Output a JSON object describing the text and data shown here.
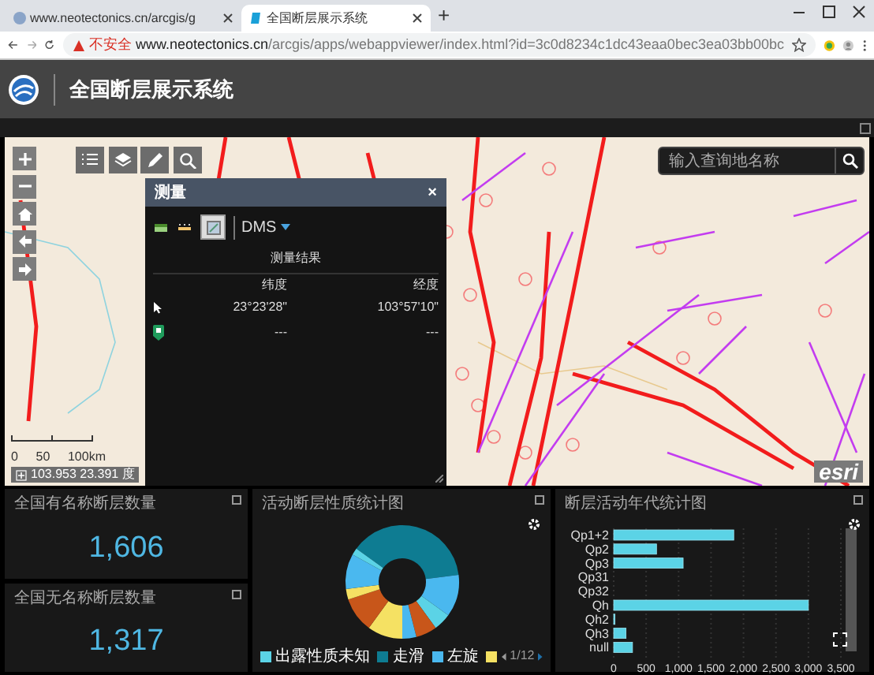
{
  "browser": {
    "tabs": [
      {
        "title": "www.neotectonics.cn/arcgis/g",
        "selected": false
      },
      {
        "title": "全国断层展示系统",
        "selected": true
      }
    ],
    "new_tab": "+",
    "security": "不安全",
    "url_host": "www.neotectonics.cn",
    "url_path": "/arcgis/apps/webappviewer/index.html?id=3c0d8234c1dc43eaa0bec3ea03bb00bc"
  },
  "app": {
    "title": "全国断层展示系统"
  },
  "map": {
    "search": {
      "placeholder": "输入查询地名称"
    },
    "scale_labels": [
      "0",
      "50",
      "100km"
    ],
    "coordinates": "103.953 23.391 度",
    "attribution": "esri"
  },
  "measure_panel": {
    "title": "测量",
    "close": "×",
    "unit": "DMS",
    "section": "测量结果",
    "columns": [
      "纬度",
      "经度"
    ],
    "rows": [
      {
        "kind": "cursor",
        "latitude": "23°23'28\"",
        "longitude": "103°57'10\""
      },
      {
        "kind": "pin",
        "latitude": "---",
        "longitude": "---"
      }
    ]
  },
  "stats": [
    {
      "title": "全国有名称断层数量",
      "value": "1,606"
    },
    {
      "title": "全国无名称断层数量",
      "value": "1,317"
    }
  ],
  "nature_chart": {
    "title": "活动断层性质统计图",
    "legend": [
      {
        "label": "出露性质未知",
        "color": "#5bd3e6"
      },
      {
        "label": "走滑",
        "color": "#0e7c92"
      },
      {
        "label": "左旋",
        "color": "#4ab8ef"
      },
      {
        "color": "#f5e163"
      }
    ],
    "page": "1/12"
  },
  "age_chart": {
    "title": "断层活动年代统计图",
    "chart_data": {
      "type": "bar",
      "orientation": "horizontal",
      "categories": [
        "Qp1+2",
        "Qp2",
        "Qp3",
        "Qp31",
        "Qp32",
        "Qh",
        "Qh2",
        "Qh3",
        "null"
      ],
      "grid": true,
      "series": [
        {
          "color": "#5bd3e6",
          "values": [
            1850,
            660,
            1070,
            0,
            0,
            3000,
            20,
            190,
            290
          ]
        }
      ],
      "xlim": [
        0,
        3500
      ],
      "xticks": [
        0,
        {
          "value": 500,
          "label": "500"
        },
        {
          "value": 1000,
          "label": "1,000"
        },
        {
          "value": 1500,
          "label": "1,500"
        },
        {
          "value": 2000,
          "label": "2,000"
        },
        {
          "value": 2500,
          "label": "2,500"
        },
        {
          "value": 3000,
          "label": "3,000"
        },
        {
          "value": 3500,
          "label": "3,500"
        }
      ]
    }
  }
}
